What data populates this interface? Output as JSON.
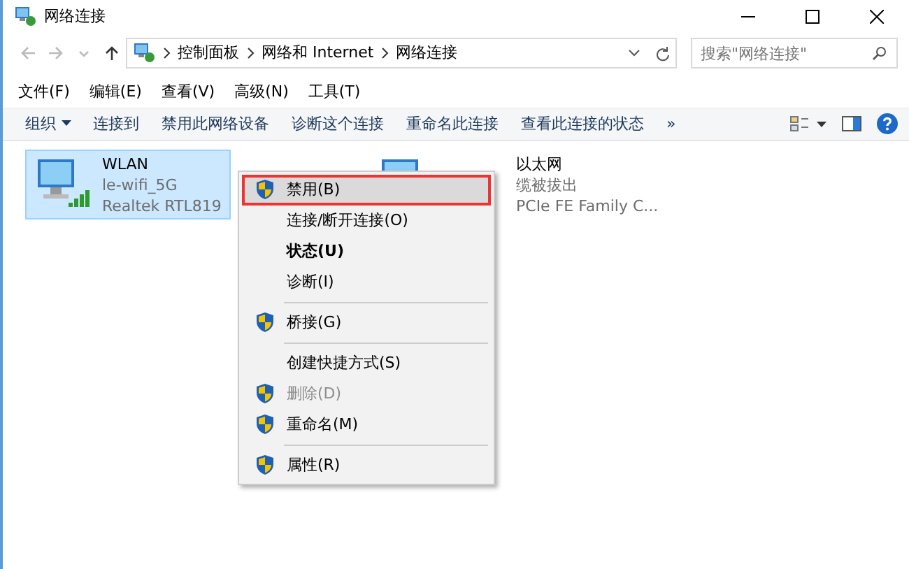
{
  "window": {
    "title": "网络连接"
  },
  "address_bar": {
    "path": [
      "控制面板",
      "网络和 Internet",
      "网络连接"
    ]
  },
  "search": {
    "placeholder": "搜索\"网络连接\""
  },
  "menu_bar": [
    "文件(F)",
    "编辑(E)",
    "查看(V)",
    "高级(N)",
    "工具(T)"
  ],
  "toolbar": [
    {
      "label": "组织",
      "kind": "dropdown"
    },
    {
      "label": "连接到",
      "kind": "plain"
    },
    {
      "label": "禁用此网络设备",
      "kind": "plain"
    },
    {
      "label": "诊断这个连接",
      "kind": "plain"
    },
    {
      "label": "重命名此连接",
      "kind": "plain"
    },
    {
      "label": "查看此连接的状态",
      "kind": "plain"
    },
    {
      "label": "»",
      "kind": "plain"
    }
  ],
  "connections": [
    {
      "name": "WLAN",
      "status": "le-wifi_5G",
      "device": "Realtek RTL819",
      "kind": "wifi",
      "selected": true
    },
    {
      "name": "以太网",
      "status": "缆被拔出",
      "device": "PCIe FE Family C...",
      "kind": "ethernet",
      "selected": false
    }
  ],
  "context_menu": [
    [
      {
        "label": "禁用(B)",
        "shield": true,
        "bold": false,
        "disabled": false,
        "selected": true
      },
      {
        "label": "连接/断开连接(O)",
        "shield": false,
        "bold": false,
        "disabled": false,
        "selected": false
      },
      {
        "label": "状态(U)",
        "shield": false,
        "bold": true,
        "disabled": false,
        "selected": false
      },
      {
        "label": "诊断(I)",
        "shield": false,
        "bold": false,
        "disabled": false,
        "selected": false
      }
    ],
    [
      {
        "label": "桥接(G)",
        "shield": true,
        "bold": false,
        "disabled": false,
        "selected": false
      }
    ],
    [
      {
        "label": "创建快捷方式(S)",
        "shield": false,
        "bold": false,
        "disabled": false,
        "selected": false
      },
      {
        "label": "删除(D)",
        "shield": true,
        "bold": false,
        "disabled": true,
        "selected": false
      },
      {
        "label": "重命名(M)",
        "shield": true,
        "bold": false,
        "disabled": false,
        "selected": false
      }
    ],
    [
      {
        "label": "属性(R)",
        "shield": true,
        "bold": false,
        "disabled": false,
        "selected": false
      }
    ]
  ]
}
